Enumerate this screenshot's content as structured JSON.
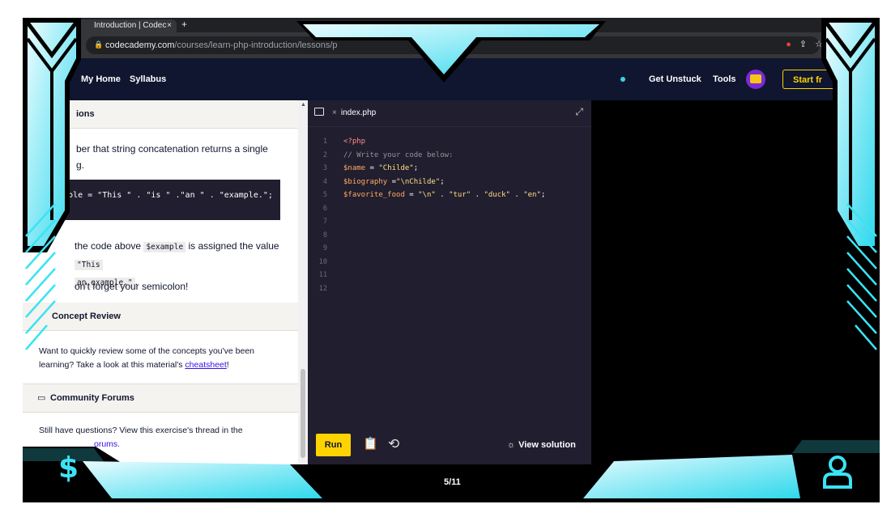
{
  "browser": {
    "tab_title": "Introduction | Codec",
    "tab_close": "×",
    "new_tab": "+",
    "url_main": "codecademy.com",
    "url_path": "/courses/learn-php-introduction/lessons/p",
    "icons": [
      "google-icon",
      "share-icon",
      "star-icon"
    ]
  },
  "nav": {
    "my_home": "My Home",
    "syllabus": "Syllabus",
    "get_unstuck": "Get Unstuck",
    "tools": "Tools",
    "start": "Start fr"
  },
  "lesson": {
    "instructions_header": "ions",
    "para1_line1": "ber that string concatenation returns a single",
    "para1_line2": "g.",
    "code_example": "xample = \"This \" . \"is \" .\"an \" . \"example.\";",
    "para2_pre": "the code above ",
    "para2_code1": "$example",
    "para2_mid": " is assigned the value ",
    "para2_code2a": "\"This",
    "para2_code2b": "an example.\"",
    "para2_post": ".",
    "semicolon_note": "on't forget your semicolon!",
    "concept_header": "Concept Review",
    "concept_text1": "Want to quickly review some of the concepts you've been",
    "concept_text2_pre": "learning? Take a look at this material's ",
    "concept_link": "cheatsheet",
    "concept_text2_post": "!",
    "forums_header": "Community Forums",
    "forums_text1": "Still have questions? View this exercise's thread in the",
    "forums_link": "orums."
  },
  "editor": {
    "file_name": "index.php",
    "line_numbers": [
      "1",
      "2",
      "3",
      "4",
      "5",
      "6",
      "7",
      "8",
      "9",
      "10",
      "11",
      "12"
    ],
    "code_lines": [
      "<?php",
      "// Write your code below:",
      "$name = \"Childe\";",
      "$biography =\"\\nChilde\";",
      "$favorite_food = \"\\n\" . \"tur\" . \"duck\" . \"en\";"
    ],
    "run_label": "Run",
    "view_solution": "View solution"
  },
  "footer": {
    "pager": "5/11"
  },
  "colors": {
    "nav_bg": "#10162f",
    "editor_bg": "#211e2f",
    "accent_yellow": "#ffd300",
    "frame_cyan": "#3be3f4"
  }
}
